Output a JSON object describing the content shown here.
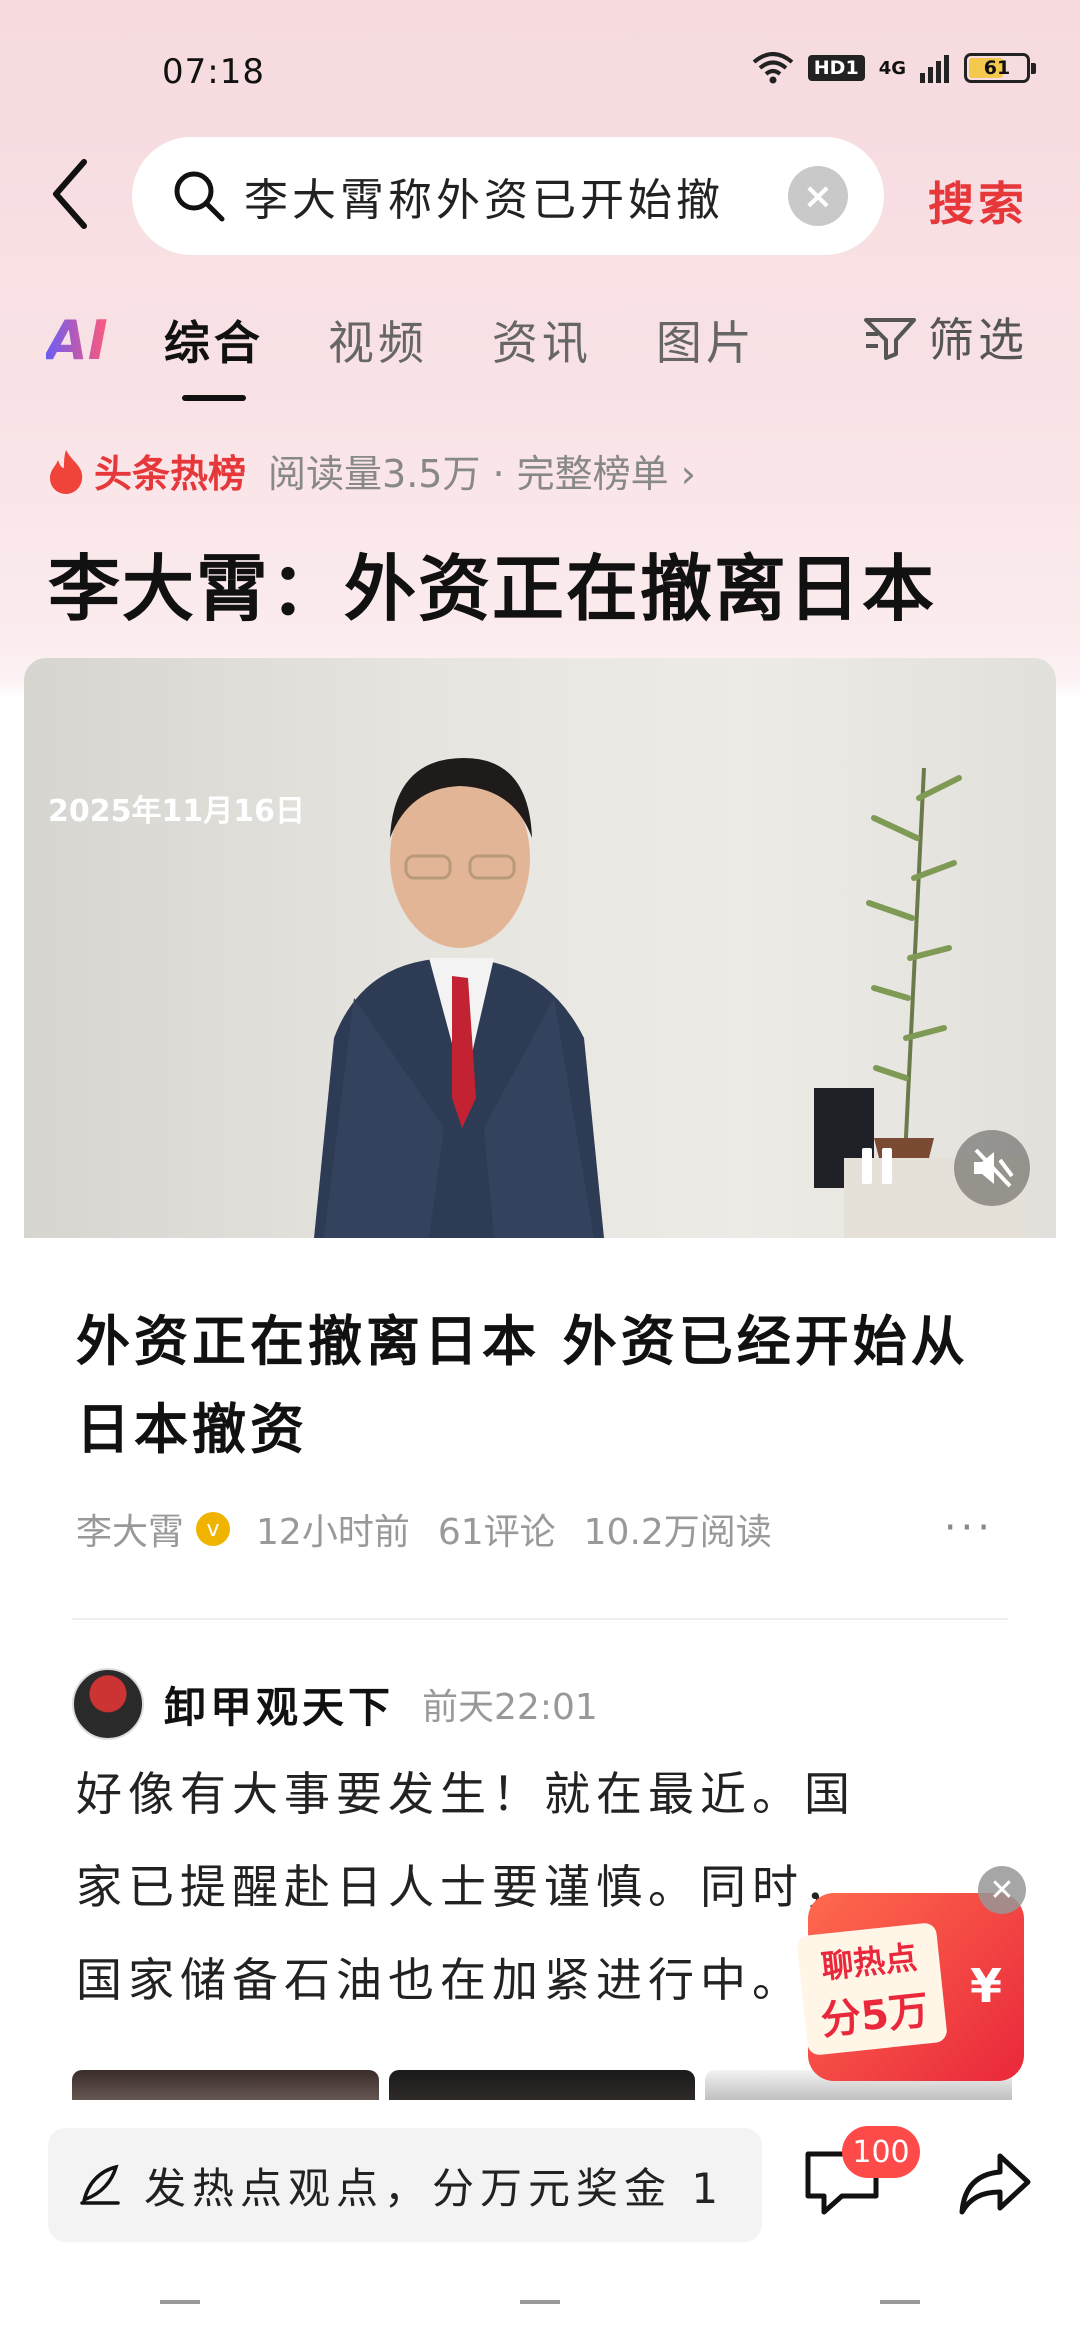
{
  "status_bar": {
    "time": "07:18",
    "hd_badge": "HD1",
    "network": "4G",
    "battery": "61",
    "battery_level": 0.61
  },
  "search": {
    "query": "李大霄称外资已开始撤",
    "button_label": "搜索"
  },
  "tabs": {
    "ai_label": "AI",
    "items": [
      "综合",
      "视频",
      "资讯",
      "图片"
    ],
    "active": "综合",
    "filter_label": "筛选"
  },
  "hot": {
    "label": "头条热榜",
    "meta": "阅读量3.5万 · 完整榜单 ›"
  },
  "headline": "李大霄：外资正在撤离日本",
  "video": {
    "date_overlay": "2025年11月16日"
  },
  "article": {
    "title": "外资正在撤离日本 外资已经开始从日本撤资",
    "author": "李大霄",
    "time": "12小时前",
    "comments": "61评论",
    "reads": "10.2万阅读",
    "more": "···"
  },
  "comment": {
    "user": "卸甲观天下",
    "time": "前天22:01",
    "body": "好像有大事要发生！就在最近。国家已提醒赴日人士要谨慎。同时，国家储备石油也在加紧进行中。隐"
  },
  "promo": {
    "line1": "聊热点",
    "line2": "分5万",
    "yen": "¥",
    "close": "✕"
  },
  "bottom_bar": {
    "input_text": "发热点观点，分万元奖金 1.",
    "message_badge": "100"
  },
  "colors": {
    "accent_red": "#e6383a",
    "badge_red": "#ff4a4a"
  }
}
